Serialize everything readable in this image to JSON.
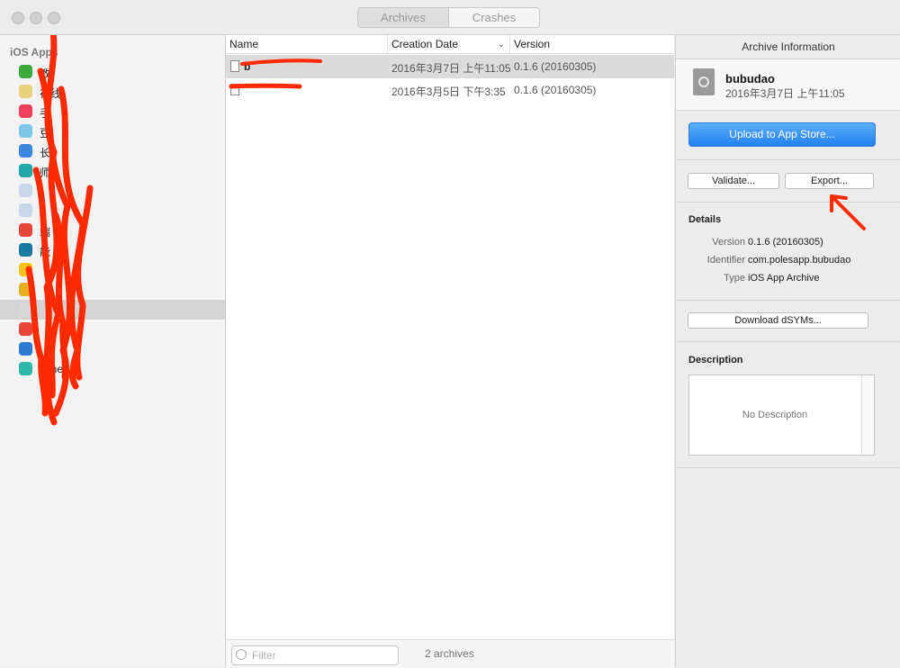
{
  "toolbar": {
    "tabs": [
      {
        "label": "Archives",
        "active": true
      },
      {
        "label": "Crashes",
        "active": false
      }
    ]
  },
  "sidebar": {
    "header": "iOS Apps",
    "items": [
      {
        "label": "教",
        "icon_color": "#3aa83a"
      },
      {
        "label": "在线",
        "icon_color": "#e9d27a"
      },
      {
        "label": "手",
        "icon_color": "#f04060"
      },
      {
        "label": "豆",
        "icon_color": "#7cc7ea"
      },
      {
        "label": "长",
        "icon_color": "#3b87e0"
      },
      {
        "label": "师",
        "icon_color": "#22a8a8"
      },
      {
        "label": "",
        "icon_color": "#c8d6e8"
      },
      {
        "label": "",
        "icon_color": "#c8d6e8"
      },
      {
        "label": "端",
        "icon_color": "#e8463a"
      },
      {
        "label": "能",
        "icon_color": "#1a7aa0"
      },
      {
        "label": "",
        "icon_color": "#f2c318"
      },
      {
        "label": "",
        "icon_color": "#e8b020"
      },
      {
        "label": "",
        "icon_color": "#d8d8d8",
        "selected": true
      },
      {
        "label": "",
        "icon_color": "#e8463a"
      },
      {
        "label": "",
        "icon_color": "#2e7ad0"
      },
      {
        "label": "acher",
        "icon_color": "#2fb8a8"
      }
    ]
  },
  "archive_list": {
    "columns": [
      "Name",
      "Creation Date",
      "Version"
    ],
    "sort_icon": "chevron-down-icon",
    "rows": [
      {
        "name": "b",
        "date": "2016年3月7日 上午11:05",
        "version": "0.1.6 (20160305)",
        "selected": true
      },
      {
        "name": "",
        "date": "2016年3月5日 下午3:35",
        "version": "0.1.6 (20160305)",
        "selected": false
      }
    ],
    "filter_placeholder": "Filter",
    "count_text": "2 archives"
  },
  "inspector": {
    "title": "Archive Information",
    "archive_name": "bubudao",
    "archive_date": "2016年3月7日 上午11:05",
    "upload_label": "Upload to App Store...",
    "validate_label": "Validate...",
    "export_label": "Export...",
    "details_heading": "Details",
    "details": [
      {
        "key": "Version",
        "value": "0.1.6 (20160305)"
      },
      {
        "key": "Identifier",
        "value": "com.polesapp.bubudao"
      },
      {
        "key": "Type",
        "value": "iOS App Archive"
      }
    ],
    "download_dsyms_label": "Download dSYMs...",
    "description_heading": "Description",
    "description_placeholder": "No Description"
  },
  "colors": {
    "accent_button": "#2580f1",
    "annotation_red": "#ff2a00"
  }
}
